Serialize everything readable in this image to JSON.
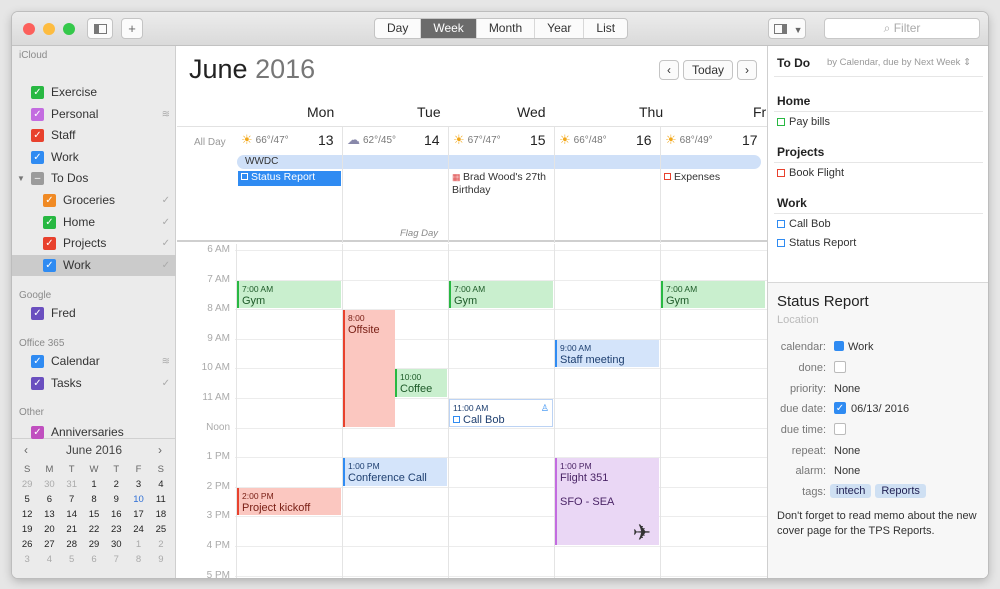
{
  "toolbar": {
    "views": [
      "Day",
      "Week",
      "Month",
      "Year",
      "List"
    ],
    "active_view": "Week",
    "add_label": "+",
    "filter_placeholder": "Filter"
  },
  "sidebar": {
    "groups": [
      {
        "name": "iCloud",
        "items": [
          {
            "label": "Exercise",
            "color": "#28b842"
          },
          {
            "label": "Personal",
            "color": "#c36ce0",
            "mark": "share"
          },
          {
            "label": "Staff",
            "color": "#e8412d"
          },
          {
            "label": "Work",
            "color": "#2f8bf2"
          },
          {
            "label": "To Dos",
            "color": "#9b9b9b",
            "group": true
          },
          {
            "label": "Groceries",
            "color": "#f08a24",
            "indent": true,
            "mark": "check"
          },
          {
            "label": "Home",
            "color": "#28b842",
            "indent": true,
            "mark": "check"
          },
          {
            "label": "Projects",
            "color": "#e8412d",
            "indent": true,
            "mark": "check"
          },
          {
            "label": "Work",
            "color": "#2f8bf2",
            "indent": true,
            "selected": true,
            "mark": "check"
          }
        ]
      },
      {
        "name": "Google",
        "items": [
          {
            "label": "Fred",
            "color": "#6a4fbf"
          }
        ]
      },
      {
        "name": "Office 365",
        "items": [
          {
            "label": "Calendar",
            "color": "#2f8bf2",
            "mark": "share"
          },
          {
            "label": "Tasks",
            "color": "#6a4fbf",
            "mark": "check"
          }
        ]
      },
      {
        "name": "Other",
        "items": [
          {
            "label": "Anniversaries",
            "color": "#c04fbf"
          }
        ]
      }
    ],
    "mini_cal": {
      "title": "June 2016",
      "weekdays": [
        "S",
        "M",
        "T",
        "W",
        "T",
        "F",
        "S"
      ],
      "rows": [
        [
          "29",
          "30",
          "31",
          "1",
          "2",
          "3",
          "4"
        ],
        [
          "5",
          "6",
          "7",
          "8",
          "9",
          "10",
          "11"
        ],
        [
          "12",
          "13",
          "14",
          "15",
          "16",
          "17",
          "18"
        ],
        [
          "19",
          "20",
          "21",
          "22",
          "23",
          "24",
          "25"
        ],
        [
          "26",
          "27",
          "28",
          "29",
          "30",
          "1",
          "2"
        ],
        [
          "3",
          "4",
          "5",
          "6",
          "7",
          "8",
          "9"
        ]
      ]
    }
  },
  "main": {
    "month": "June",
    "year": "2016",
    "today_label": "Today",
    "allday_label": "All Day",
    "days": [
      {
        "name": "Mon",
        "num": "13",
        "weather": "66°/47°"
      },
      {
        "name": "Tue",
        "num": "14",
        "weather": "62°/45°"
      },
      {
        "name": "Wed",
        "num": "15",
        "weather": "67°/47°"
      },
      {
        "name": "Thu",
        "num": "16",
        "weather": "66°/48°"
      },
      {
        "name": "Fri",
        "num": "17",
        "weather": "68°/49°"
      }
    ],
    "allday_events": {
      "wwdc": "WWDC",
      "status": "Status Report",
      "brad": "Brad Wood's 27th Birthday",
      "expenses": "Expenses",
      "flag": "Flag Day"
    },
    "hours": [
      "6 AM",
      "7 AM",
      "8 AM",
      "9 AM",
      "10 AM",
      "11 AM",
      "Noon",
      "1 PM",
      "2 PM",
      "3 PM",
      "4 PM",
      "5 PM"
    ],
    "events": [
      {
        "time": "7:00 AM",
        "name": "Gym"
      },
      {
        "time": "7:00 AM",
        "name": "Gym"
      },
      {
        "time": "7:00 AM",
        "name": "Gym"
      },
      {
        "time": "8:00",
        "name": "Offsite"
      },
      {
        "time": "10:00",
        "name": "Coffee"
      },
      {
        "time": "9:00 AM",
        "name": "Staff meeting"
      },
      {
        "time": "11:00 AM",
        "name": "Call Bob"
      },
      {
        "time": "1:00 PM",
        "name": "Conference Call"
      },
      {
        "time": "1:00 PM",
        "name": "Flight 351",
        "extra": "SFO - SEA"
      },
      {
        "time": "2:00 PM",
        "name": "Project kickoff"
      }
    ]
  },
  "todo": {
    "title": "To Do",
    "subtitle": "by Calendar, due by Next Week",
    "sections": [
      {
        "name": "Home",
        "items": [
          {
            "label": "Pay bills",
            "color": "#28b842"
          }
        ]
      },
      {
        "name": "Projects",
        "items": [
          {
            "label": "Book Flight",
            "color": "#e8412d"
          }
        ]
      },
      {
        "name": "Work",
        "items": [
          {
            "label": "Call Bob",
            "color": "#2f8bf2"
          },
          {
            "label": "Status Report",
            "color": "#2f8bf2"
          }
        ]
      }
    ]
  },
  "detail": {
    "title": "Status Report",
    "location_placeholder": "Location",
    "labels": {
      "calendar": "calendar:",
      "done": "done:",
      "priority": "priority:",
      "due_date": "due date:",
      "due_time": "due time:",
      "repeat": "repeat:",
      "alarm": "alarm:",
      "tags": "tags:"
    },
    "calendar": "Work",
    "priority": "None",
    "due_date": "06/13/ 2016",
    "repeat": "None",
    "alarm": "None",
    "tags": [
      "intech",
      "Reports"
    ],
    "memo": "Don't forget to read memo about the new cover page for the TPS Reports."
  }
}
